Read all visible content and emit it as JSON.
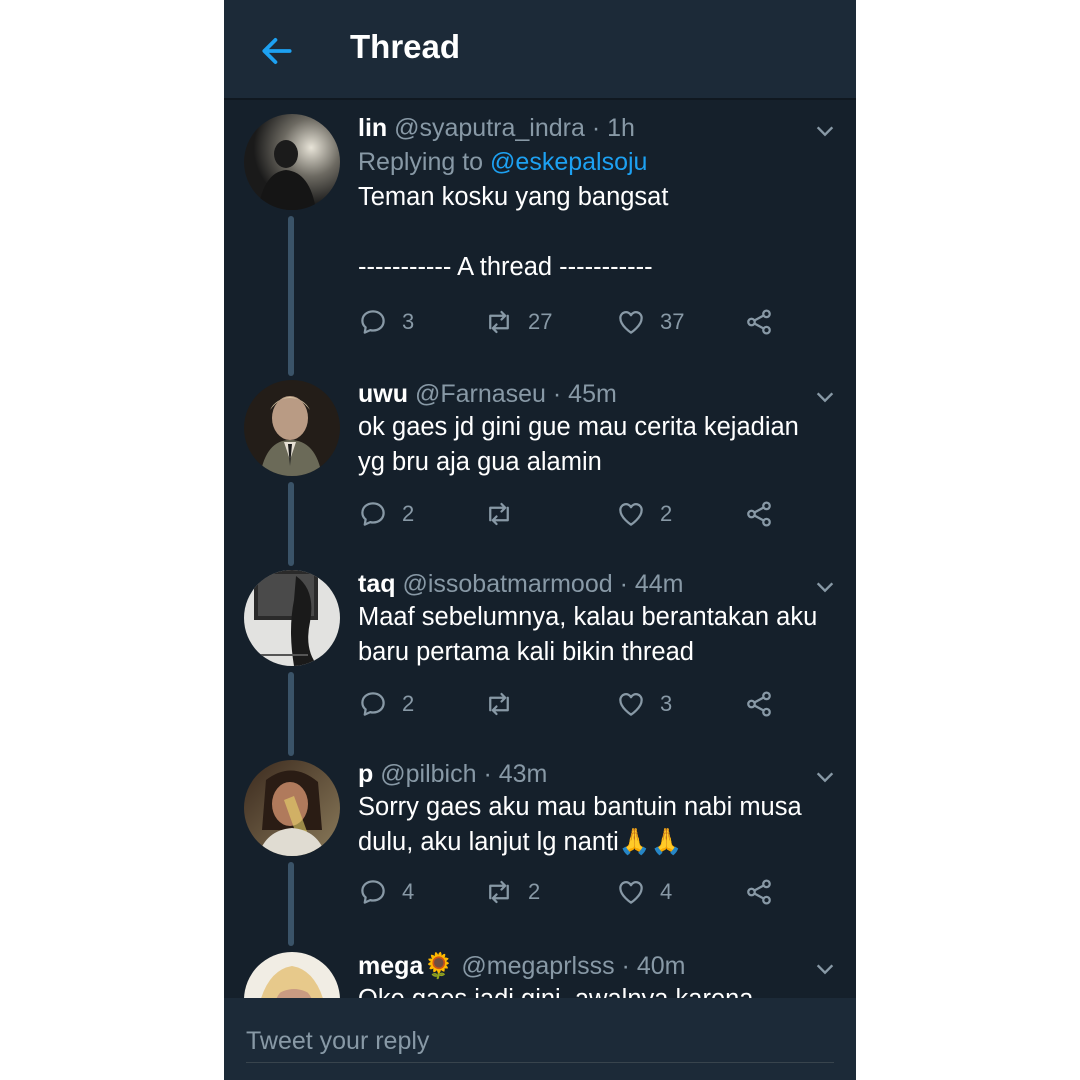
{
  "header": {
    "title": "Thread"
  },
  "colors": {
    "background": "#15202b",
    "header": "#1c2a38",
    "accent": "#1da1f2",
    "muted": "#8899a6",
    "text": "#ffffff"
  },
  "tweets": [
    {
      "name": "lin",
      "handle": "@syaputra_indra",
      "time": "· 1h",
      "replying_prefix": "Replying to",
      "replying_handle": "@eskepalsoju",
      "text": "Teman kosku yang bangsat\n\n----------- A thread -----------",
      "replies": "3",
      "retweets": "27",
      "likes": "37"
    },
    {
      "name": "uwu",
      "handle": "@Farnaseu",
      "time": "· 45m",
      "text": "ok gaes jd gini gue mau cerita kejadian\nyg bru aja gua alamin",
      "replies": "2",
      "retweets": "",
      "likes": "2"
    },
    {
      "name": "taq",
      "handle": "@issobatmarmood",
      "time": "· 44m",
      "text": "Maaf sebelumnya, kalau berantakan aku\nbaru pertama kali bikin thread",
      "replies": "2",
      "retweets": "",
      "likes": "3"
    },
    {
      "name": "p",
      "handle": "@pilbich",
      "time": "· 43m",
      "text": "Sorry gaes aku mau bantuin nabi musa\ndulu, aku lanjut lg nanti🙏🙏",
      "replies": "4",
      "retweets": "2",
      "likes": "4"
    },
    {
      "name": "mega🌻",
      "handle": "@megaprlsss",
      "time": "· 40m",
      "text": "Oke gaes jadi gini, awalnya karena",
      "replies": "",
      "retweets": "",
      "likes": ""
    }
  ],
  "composer": {
    "placeholder": "Tweet your reply"
  }
}
